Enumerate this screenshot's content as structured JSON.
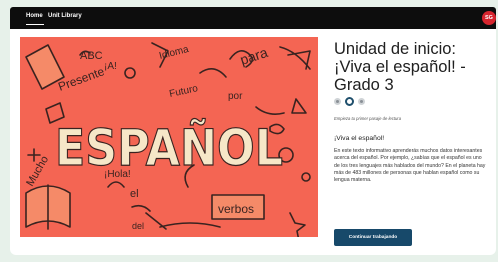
{
  "nav": {
    "home_label": "Home",
    "unit_library_label": "Unit Library",
    "avatar_initials": "SG"
  },
  "hero": {
    "main_word": "ESPAÑOL",
    "doodle_words": [
      "ABC",
      "Idioma",
      "para",
      "Presente",
      "Futuro",
      "por",
      "Mucho",
      "¡Hola!",
      "el",
      "verbos",
      "del",
      "¡A!"
    ]
  },
  "unit": {
    "title": "Unidad de inicio: ¡Viva el español! - Grado 3",
    "subtitle": "Empieza tu primer pasaje de lectura",
    "section_heading": "¡Viva el español!",
    "description": "En este texto informativo aprenderás muchos datos interesantes acerca del español. Por ejemplo, ¿sabías que el español es uno de los tres lenguajes más hablados del mundo? En el planeta hay más de 483 millones de personas que hablan español como su lengua materna.",
    "continue_label": "Continuar trabajando"
  },
  "carousel": {
    "count": 3,
    "active_index": 1
  },
  "colors": {
    "hero_background": "#f46553",
    "hero_lettering": "#f6e7c8",
    "cta_background": "#17496a",
    "avatar_background": "#d6252e"
  }
}
